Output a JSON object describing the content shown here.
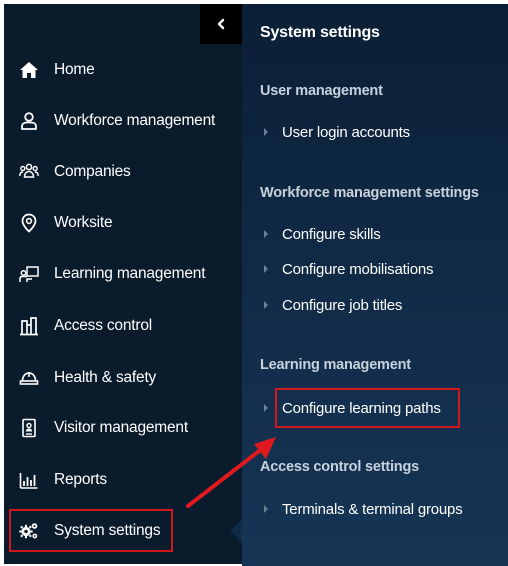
{
  "sidebar": {
    "items": [
      {
        "label": "Home",
        "icon": "home-icon"
      },
      {
        "label": "Workforce management",
        "icon": "person-icon"
      },
      {
        "label": "Companies",
        "icon": "group-icon"
      },
      {
        "label": "Worksite",
        "icon": "location-pin-icon"
      },
      {
        "label": "Learning management",
        "icon": "classroom-icon"
      },
      {
        "label": "Access control",
        "icon": "gate-icon"
      },
      {
        "label": "Health & safety",
        "icon": "hard-hat-icon"
      },
      {
        "label": "Visitor management",
        "icon": "badge-icon"
      },
      {
        "label": "Reports",
        "icon": "bar-chart-icon"
      },
      {
        "label": "System settings",
        "icon": "gears-icon"
      }
    ],
    "active_item": "System settings"
  },
  "panel": {
    "title": "System settings",
    "sections": [
      {
        "heading": "User management",
        "items": [
          "User login accounts"
        ]
      },
      {
        "heading": "Workforce management settings",
        "items": [
          "Configure skills",
          "Configure mobilisations",
          "Configure job titles"
        ]
      },
      {
        "heading": "Learning management",
        "items": [
          "Configure learning paths"
        ]
      },
      {
        "heading": "Access control settings",
        "items": [
          "Terminals & terminal groups"
        ]
      }
    ]
  },
  "colors": {
    "sidebar_bg": "#0a1b2c",
    "panel_bg": "#122d4a",
    "highlight": "#d1181d",
    "text": "#ffffff"
  }
}
